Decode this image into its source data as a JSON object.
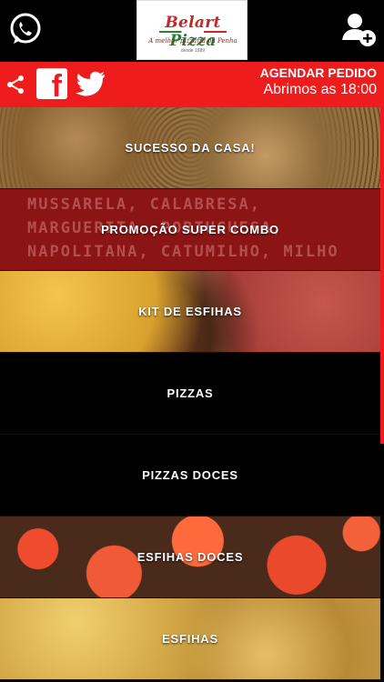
{
  "header": {
    "logo_brand_part1": "Belart",
    "logo_brand_part2": "Pizza",
    "logo_tagline": "A melhor pizzaria da Penha",
    "logo_since": "desde 1989",
    "icons": [
      "whatsapp-icon",
      "add-user-icon"
    ]
  },
  "action_bar": {
    "icons": [
      "share-icon",
      "facebook-icon",
      "twitter-icon"
    ],
    "schedule_label": "AGENDAR PEDIDO",
    "opening_label": "Abrimos as 18:00"
  },
  "colors": {
    "accent": "#ee1c1c",
    "background": "#000000"
  },
  "categories": [
    {
      "label": "SUCESSO DA CASA!"
    },
    {
      "label": "PROMOÇÃO SUPER COMBO",
      "banner_text": [
        "MUSSARELA, CALABRESA,",
        "MARGUERITA, PORTUGUESA,",
        "NAPOLITANA, CATUMILHO, MILHO"
      ]
    },
    {
      "label": "KIT DE ESFIHAS"
    },
    {
      "label": "PIZZAS"
    },
    {
      "label": "PIZZAS DOCES"
    },
    {
      "label": "ESFIHAS DOCES"
    },
    {
      "label": "ESFIHAS"
    }
  ]
}
